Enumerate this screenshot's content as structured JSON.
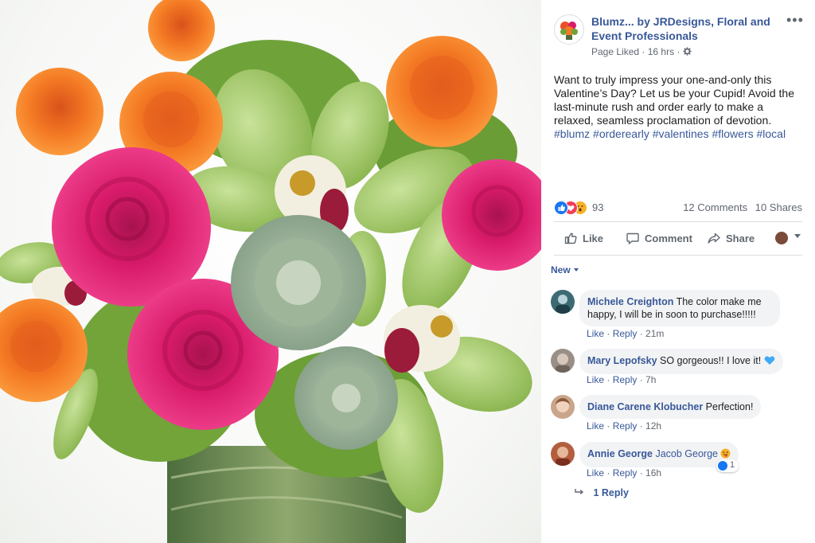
{
  "post": {
    "page_name": "Blumz... by JRDesigns, Floral and Event Professionals",
    "meta_liked": "Page Liked",
    "meta_sep": "·",
    "meta_time": "16 hrs",
    "more_label": "•••",
    "text_main": "Want to truly impress your one-and-only this Valentine’s Day? Let us be your Cupid! Avoid the last-minute rush and order early to make a relaxed, seamless proclamation of devotion.",
    "hashtags": [
      "#blumz",
      "#orderearly",
      "#valentines",
      "#flowers",
      "#local"
    ]
  },
  "counts": {
    "reactions": "93",
    "comments": "12 Comments",
    "shares": "10 Shares"
  },
  "actions": {
    "like": "Like",
    "comment": "Comment",
    "share": "Share"
  },
  "sort_label": "New",
  "comments": [
    {
      "author": "Michele Creighton",
      "text": "The color make me happy, I will be in soon to purchase!!!!!",
      "like": "Like",
      "reply": "Reply",
      "time": "21m"
    },
    {
      "author": "Mary Lepofsky",
      "text": "SO gorgeous!! I love it!",
      "like": "Like",
      "reply": "Reply",
      "time": "7h"
    },
    {
      "author": "Diane Carene Klobucher",
      "text": "Perfection!",
      "like": "Like",
      "reply": "Reply",
      "time": "12h"
    },
    {
      "author": "Annie George",
      "text": "Jacob George",
      "like": "Like",
      "reply": "Reply",
      "time": "16h",
      "reaction_count": "1"
    }
  ],
  "reply_link": "1 Reply",
  "colors": {
    "link_blue": "#385898",
    "like_blue": "#1877f2",
    "love_red": "#f33e58",
    "wow_yellow": "#f7b125",
    "muted_gray": "#606770",
    "bubble_bg": "#f2f3f5"
  },
  "icons": {
    "more": "ellipsis-icon",
    "audience": "gear-icon",
    "like": "thumbs-up-icon",
    "comment": "speech-bubble-icon",
    "share": "share-arrow-icon"
  }
}
